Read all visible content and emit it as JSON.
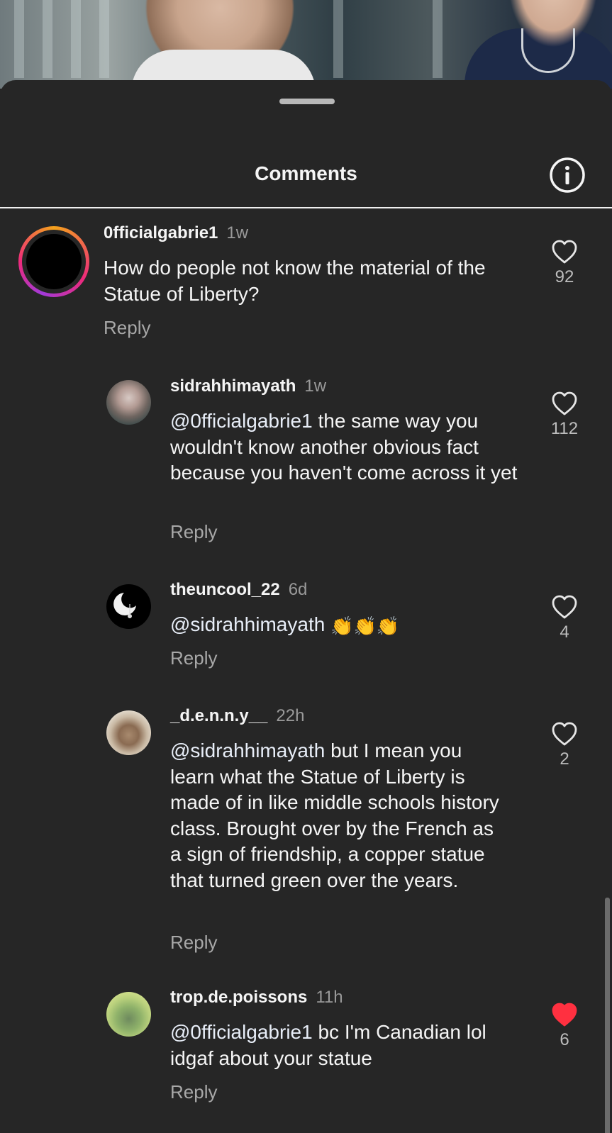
{
  "header": {
    "title": "Comments",
    "info_icon": "info-circle-icon"
  },
  "comments": [
    {
      "username": "0fficialgabrie1",
      "time": "1w",
      "text": "How do people not know the material of the Statue of Liberty?",
      "reply_label": "Reply",
      "likes": "92",
      "liked": false
    },
    {
      "username": "sidrahhimayath",
      "time": "1w",
      "mention": "@0fficialgabrie1",
      "text": " the same way you wouldn't know another obvious fact because you haven't come across it yet",
      "reply_label": "Reply",
      "likes": "112",
      "liked": false
    },
    {
      "username": "theuncool_22",
      "time": "6d",
      "mention": "@sidrahhimayath",
      "emoji": "👏👏👏",
      "reply_label": "Reply",
      "likes": "4",
      "liked": false
    },
    {
      "username": "_d.e.n.n.y__",
      "time": "22h",
      "mention": "@sidrahhimayath",
      "text": " but I mean you learn what the Statue of Liberty is made of in like middle schools history class. Brought over by the French as a sign of friendship, a copper statue that turned green over the years.",
      "reply_label": "Reply",
      "likes": "2",
      "liked": false
    },
    {
      "username": "trop.de.poissons",
      "time": "11h",
      "mention": "@0fficialgabrie1",
      "text": " bc I'm Canadian lol idgaf about your statue",
      "reply_label": "Reply",
      "likes": "6",
      "liked": true
    }
  ],
  "colors": {
    "background": "#262626",
    "liked_heart": "#ff3040",
    "secondary_text": "#a8a8a8"
  }
}
